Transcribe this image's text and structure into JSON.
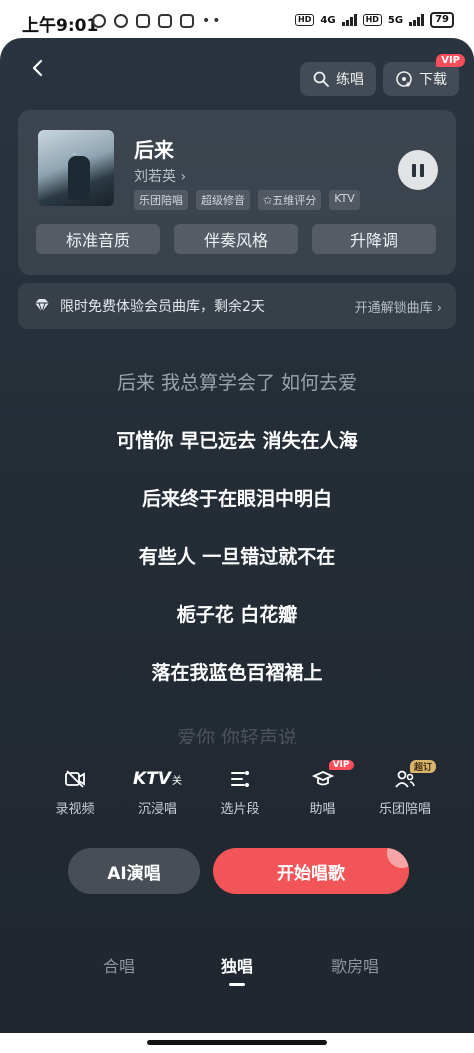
{
  "status": {
    "time": "上午9:01",
    "net1": "4G",
    "net2": "5G",
    "hd": "HD",
    "battery": "79"
  },
  "header": {
    "practice_label": "练唱",
    "download_label": "下载",
    "vip_badge": "VIP"
  },
  "song": {
    "title": "后来",
    "artist": "刘若英 ›",
    "tags": [
      "乐团陪唱",
      "超级修音",
      "✩五维评分",
      "KTV"
    ],
    "options": [
      "标准音质",
      "伴奏风格",
      "升降调"
    ]
  },
  "promo": {
    "text": "限时免费体验会员曲库，剩余2天",
    "link": "开通解锁曲库 ›"
  },
  "lyrics": [
    "后来 我总算学会了 如何去爱",
    "可惜你 早已远去 消失在人海",
    "后来终于在眼泪中明白",
    "有些人 一旦错过就不在",
    "栀子花 白花瓣",
    "落在我蓝色百褶裙上",
    "爱你 你轻声说"
  ],
  "tools": [
    {
      "label": "录视频",
      "icon": "video-off-icon"
    },
    {
      "label": "沉浸唱",
      "icon": "ktv-icon",
      "icon_text": "KTV",
      "sub": "关"
    },
    {
      "label": "选片段",
      "icon": "segment-icon"
    },
    {
      "label": "助唱",
      "icon": "assist-icon",
      "badge": "VIP"
    },
    {
      "label": "乐团陪唱",
      "icon": "band-icon",
      "badge": "超订"
    }
  ],
  "actions": {
    "ai_label": "AI演唱",
    "start_label": "开始唱歌"
  },
  "tabs": [
    "合唱",
    "独唱",
    "歌房唱"
  ],
  "active_tab": "独唱",
  "colors": {
    "accent": "#f25557",
    "vip": "#ff4d5a",
    "background": "#252d37"
  }
}
